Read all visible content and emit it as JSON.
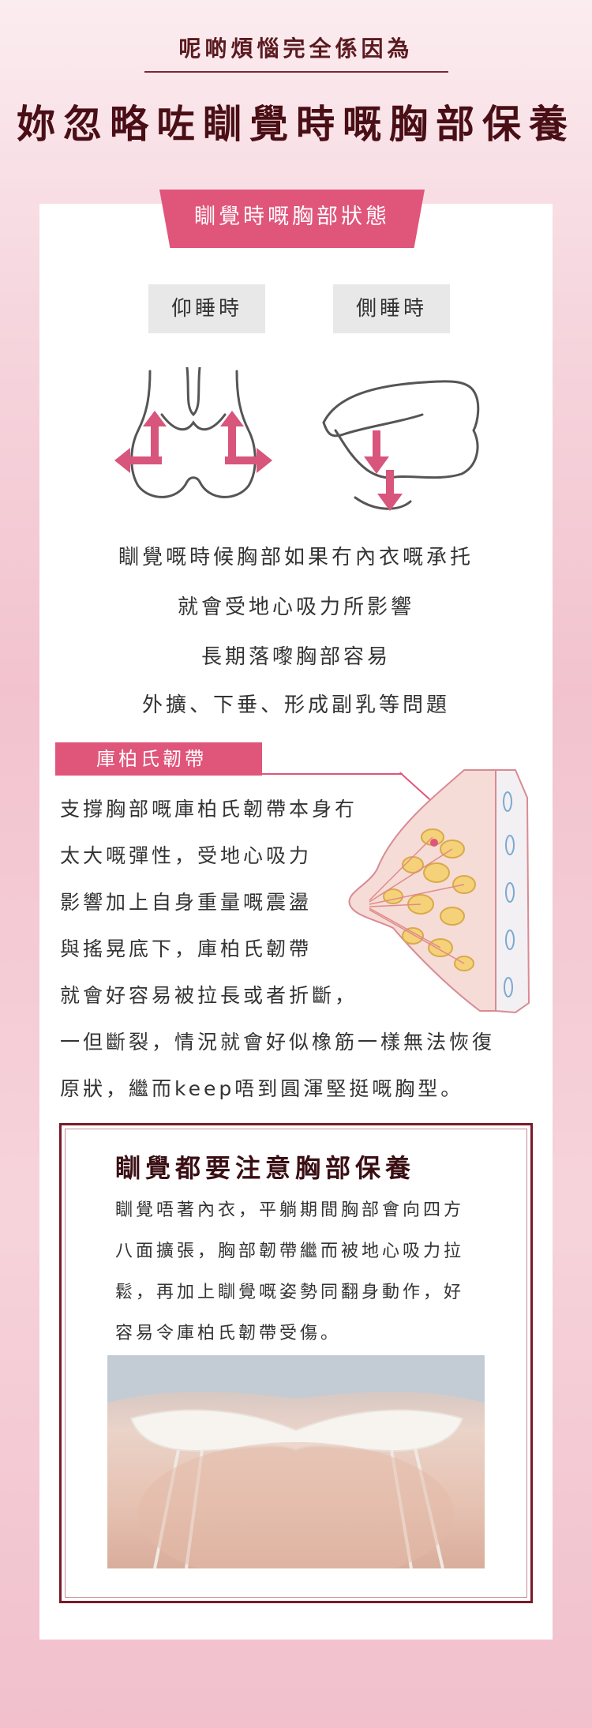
{
  "header": {
    "subtitle": "呢啲煩惱完全係因為",
    "title": "妳忽略咗瞓覺時嘅胸部保養"
  },
  "section1": {
    "banner": "瞓覺時嘅胸部狀態",
    "pill_left": "仰睡時",
    "pill_right": "側睡時",
    "lines": [
      "瞓覺嘅時候胸部如果冇內衣嘅承托",
      "就會受地心吸力所影響",
      "長期落嚟胸部容易",
      "外擴、下垂、形成副乳等問題"
    ]
  },
  "section2": {
    "tag": "庫柏氏韌帶",
    "lines": [
      "支撐胸部嘅庫柏氏韌帶本身冇",
      "太大嘅彈性，受地心吸力",
      "影響加上自身重量嘅震盪",
      "與搖晃底下，庫柏氏韌帶",
      "就會好容易被拉長或者折斷，",
      "一但斷裂，情況就會好似橡筋一樣無法恢復",
      "原狀，繼而keep唔到圓渾堅挺嘅胸型。"
    ]
  },
  "section3": {
    "title": "瞓覺都要注意胸部保養",
    "lines": [
      "瞓覺唔著內衣，平躺期間胸部會向四方",
      "八面擴張，胸部韌帶繼而被地心吸力拉",
      "鬆，再加上瞓覺嘅姿勢同翻身動作，好",
      "容易令庫柏氏韌帶受傷。"
    ]
  },
  "colors": {
    "accent": "#e0557a",
    "dark_red": "#7a1a28",
    "title": "#4a0f16"
  }
}
